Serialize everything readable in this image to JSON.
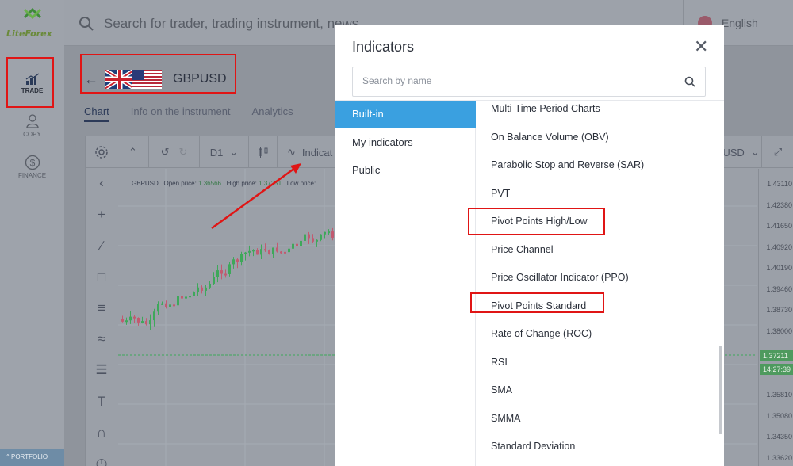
{
  "brand": {
    "logo_text": "LiteForex"
  },
  "sidebar": {
    "items": [
      {
        "label": "TRADE",
        "icon": "chart-bars-icon"
      },
      {
        "label": "COPY",
        "icon": "user-icon"
      },
      {
        "label": "FINANCE",
        "icon": "dollar-icon"
      }
    ],
    "portfolio_label": "PORTFOLIO"
  },
  "header": {
    "search_placeholder": "Search for trader, trading instrument, news",
    "language": "English"
  },
  "instrument": {
    "symbol": "GBPUSD",
    "tabs": [
      "Chart",
      "Info on the instrument",
      "Analytics"
    ],
    "active_tab": "Chart"
  },
  "chart_toolbar": {
    "timeframe": "D1",
    "indicators_label": "Indicat",
    "currency_label": "USD"
  },
  "chart_info": {
    "symbol": "GBPUSD",
    "open_label": "Open price:",
    "open_value": "1.36566",
    "high_label": "High price:",
    "high_value": "1.37251",
    "low_label": "Low price:"
  },
  "price_axis": {
    "labels": [
      "1.43110",
      "1.42380",
      "1.41650",
      "1.40920",
      "1.40190",
      "1.39460",
      "1.38730",
      "1.38000",
      "1.37211",
      "14:27:39",
      "1.35810",
      "1.35080",
      "1.34350",
      "1.33620"
    ]
  },
  "modal": {
    "title": "Indicators",
    "search_placeholder": "Search by name",
    "categories": [
      "Built-in",
      "My indicators",
      "Public"
    ],
    "selected_category": "Built-in",
    "indicators": [
      "Multi-Time Period Charts",
      "On Balance Volume (OBV)",
      "Parabolic Stop and Reverse (SAR)",
      "PVT",
      "Pivot Points High/Low",
      "Price Channel",
      "Price Oscillator Indicator (PPO)",
      "Pivot Points Standard",
      "Rate of Change (ROC)",
      "RSI",
      "SMA",
      "SMMA",
      "Standard Deviation"
    ]
  },
  "colors": {
    "highlight_box": "#e01515",
    "selected_category": "#3aa0e0",
    "candle_up": "#3ea85a",
    "candle_down": "#c25a70"
  }
}
